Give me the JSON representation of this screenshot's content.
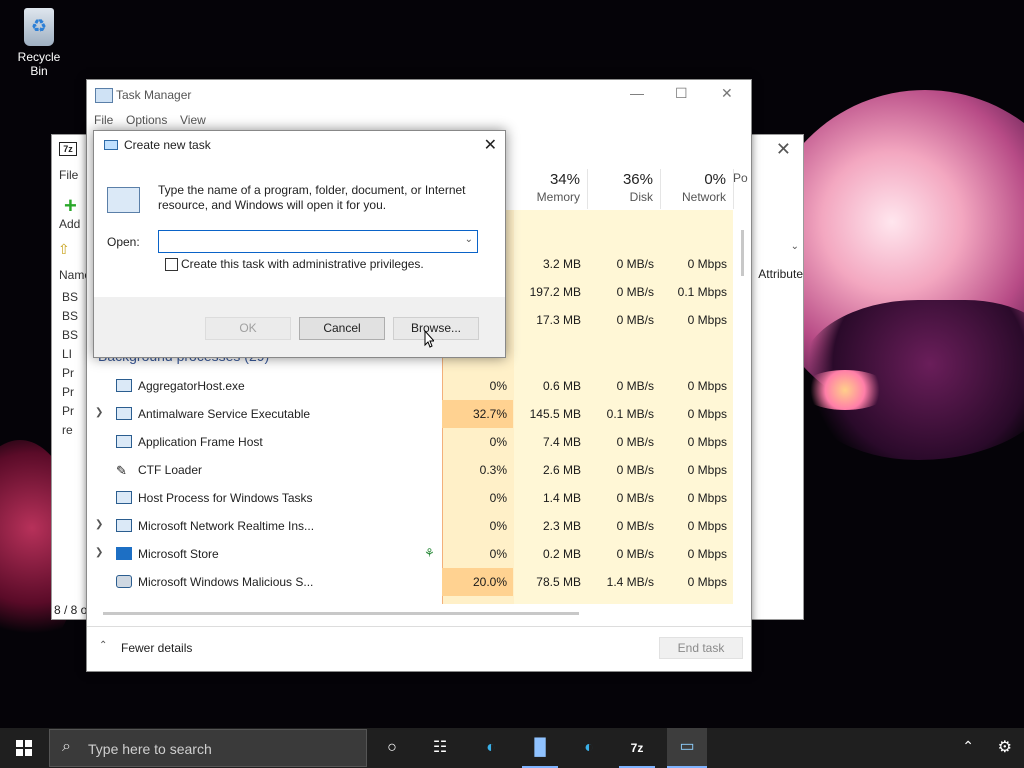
{
  "desktop": {
    "recycle_bin_label": "Recycle Bin"
  },
  "zip_window": {
    "menu_file": "File",
    "add_label": "Add",
    "name_col": "Name",
    "attributes_col": "Attribute",
    "rows": [
      "BS",
      "BS",
      "BS",
      "LI",
      "Pr",
      "Pr",
      "Pr",
      "re"
    ],
    "status": "8 / 8 o"
  },
  "task_manager": {
    "title": "Task Manager",
    "menu": [
      "File",
      "Options",
      "View"
    ],
    "columns": [
      {
        "pct": "34%",
        "label": "Memory"
      },
      {
        "pct": "36%",
        "label": "Disk"
      },
      {
        "pct": "0%",
        "label": "Network"
      },
      {
        "pct": "",
        "label": "Po"
      }
    ],
    "top_rows": [
      {
        "mem": "3.2 MB",
        "disk": "0 MB/s",
        "net": "0 Mbps"
      },
      {
        "mem": "197.2 MB",
        "disk": "0 MB/s",
        "net": "0.1 Mbps"
      },
      {
        "mem": "17.3 MB",
        "disk": "0 MB/s",
        "net": "0 Mbps"
      }
    ],
    "background_title": "Background processes (29)",
    "processes": [
      {
        "name": "AggregatorHost.exe",
        "cpu": "0%",
        "mem": "0.6 MB",
        "disk": "0 MB/s",
        "net": "0 Mbps",
        "expand": false
      },
      {
        "name": "Antimalware Service Executable",
        "cpu": "32.7%",
        "mem": "145.5 MB",
        "disk": "0.1 MB/s",
        "net": "0 Mbps",
        "expand": true
      },
      {
        "name": "Application Frame Host",
        "cpu": "0%",
        "mem": "7.4 MB",
        "disk": "0 MB/s",
        "net": "0 Mbps",
        "expand": false
      },
      {
        "name": "CTF Loader",
        "cpu": "0.3%",
        "mem": "2.6 MB",
        "disk": "0 MB/s",
        "net": "0 Mbps",
        "expand": false
      },
      {
        "name": "Host Process for Windows Tasks",
        "cpu": "0%",
        "mem": "1.4 MB",
        "disk": "0 MB/s",
        "net": "0 Mbps",
        "expand": false
      },
      {
        "name": "Microsoft Network Realtime Ins...",
        "cpu": "0%",
        "mem": "2.3 MB",
        "disk": "0 MB/s",
        "net": "0 Mbps",
        "expand": true
      },
      {
        "name": "Microsoft Store",
        "cpu": "0%",
        "mem": "0.2 MB",
        "disk": "0 MB/s",
        "net": "0 Mbps",
        "expand": true
      },
      {
        "name": "Microsoft Windows Malicious S...",
        "cpu": "20.0%",
        "mem": "78.5 MB",
        "disk": "1.4 MB/s",
        "net": "0 Mbps",
        "expand": false
      }
    ],
    "fewer_details": "Fewer details",
    "end_task": "End task"
  },
  "dialog": {
    "title": "Create new task",
    "description": "Type the name of a program, folder, document, or Internet resource, and Windows will open it for you.",
    "open_label": "Open:",
    "open_value": "",
    "admin_checkbox": "Create this task with administrative privileges.",
    "ok": "OK",
    "cancel": "Cancel",
    "browse": "Browse..."
  },
  "taskbar": {
    "search_placeholder": "Type here to search"
  }
}
